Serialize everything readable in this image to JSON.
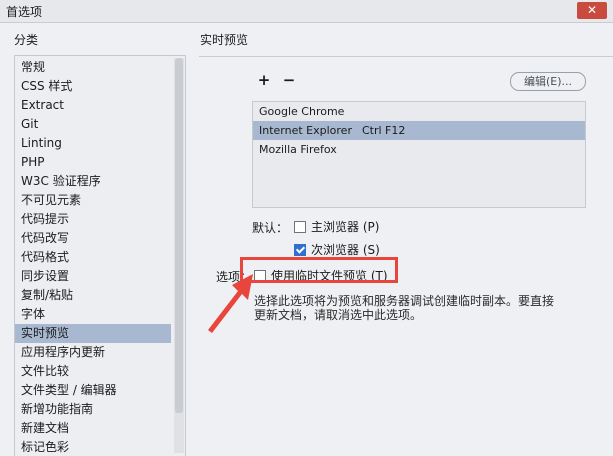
{
  "window": {
    "title": "首选项",
    "close_glyph": "✕"
  },
  "sidebar": {
    "label": "分类",
    "items": [
      {
        "label": "常规"
      },
      {
        "label": "CSS 样式"
      },
      {
        "label": "Extract"
      },
      {
        "label": "Git"
      },
      {
        "label": "Linting"
      },
      {
        "label": "PHP"
      },
      {
        "label": "W3C 验证程序"
      },
      {
        "label": "不可见元素"
      },
      {
        "label": "代码提示"
      },
      {
        "label": "代码改写"
      },
      {
        "label": "代码格式"
      },
      {
        "label": "同步设置"
      },
      {
        "label": "复制/粘贴"
      },
      {
        "label": "字体"
      },
      {
        "label": "实时预览",
        "selected": true
      },
      {
        "label": "应用程序内更新"
      },
      {
        "label": "文件比较"
      },
      {
        "label": "文件类型 / 编辑器"
      },
      {
        "label": "新增功能指南"
      },
      {
        "label": "新建文档"
      },
      {
        "label": "标记色彩"
      }
    ]
  },
  "main": {
    "title": "实时预览",
    "toolbar": {
      "add_label": "+",
      "remove_label": "−",
      "edit_label": "编辑(E)..."
    },
    "browsers": [
      {
        "name": "Google Chrome",
        "shortcut": ""
      },
      {
        "name": "Internet Explorer",
        "shortcut": "Ctrl F12",
        "selected": true
      },
      {
        "name": "Mozilla Firefox",
        "shortcut": ""
      }
    ],
    "defaults": {
      "label": "默认：",
      "primary": {
        "label": "主浏览器 (P)",
        "checked": false
      },
      "secondary": {
        "label": "次浏览器 (S)",
        "checked": true
      }
    },
    "options": {
      "label": "选项：",
      "temp_file": {
        "label": "使用临时文件预览 (T)",
        "checked": false
      },
      "description": "选择此选项将为预览和服务器调试创建临时副本。要直接更新文档，请取消选中此选项。"
    }
  },
  "colors": {
    "highlight": "#e8463c",
    "selection": "#a7b8d0",
    "checkbox": "#2f6fcf"
  }
}
